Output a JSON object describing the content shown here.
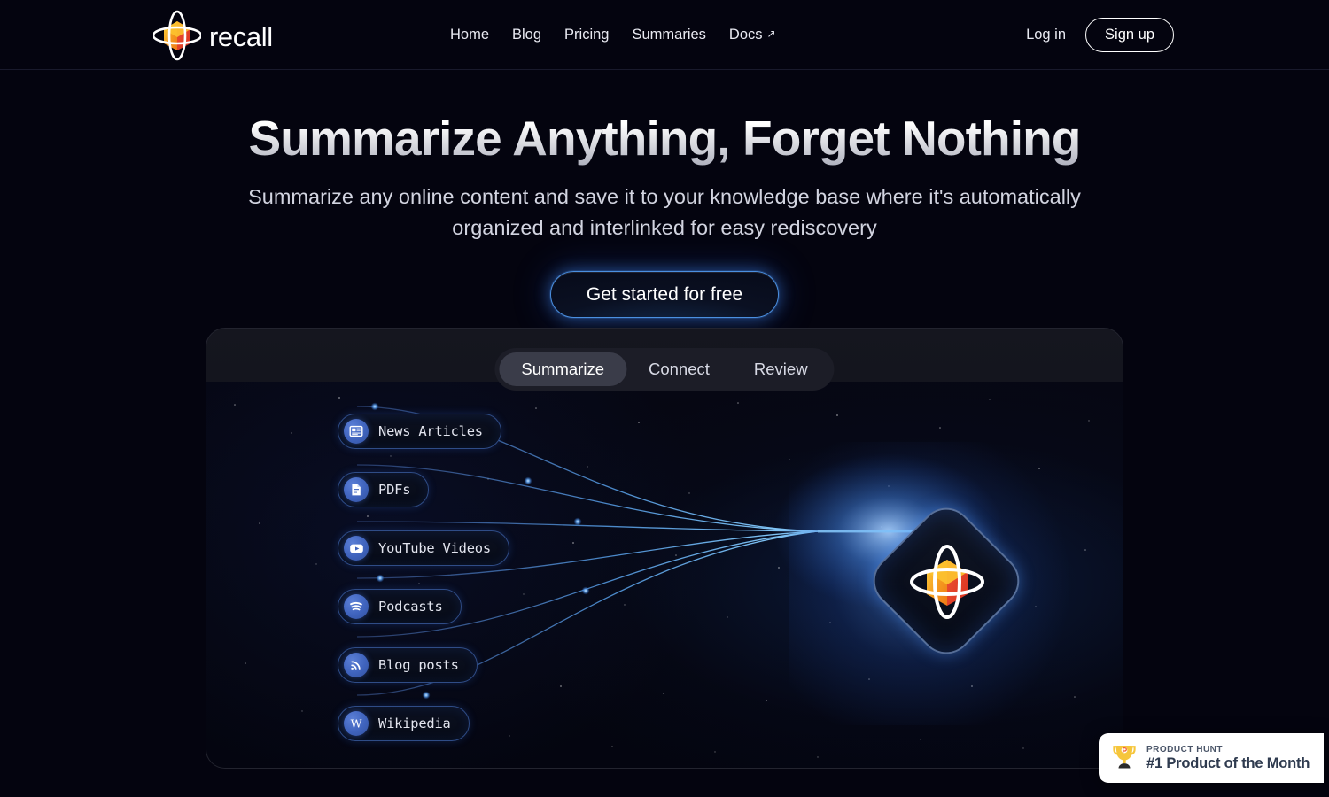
{
  "header": {
    "brand_name": "recall",
    "brand_logo_icon": "recall-orbit-logo",
    "nav": [
      {
        "label": "Home",
        "icon": null
      },
      {
        "label": "Blog",
        "icon": null
      },
      {
        "label": "Pricing",
        "icon": null
      },
      {
        "label": "Summaries",
        "icon": null
      },
      {
        "label": "Docs",
        "icon": "external-link-arrow-icon",
        "arrow": "↗"
      }
    ],
    "login_label": "Log in",
    "signup_label": "Sign up"
  },
  "hero": {
    "title": "Summarize Anything, Forget Nothing",
    "subtitle": "Summarize any online content and save it to your knowledge base where it's automatically organized and interlinked for easy rediscovery",
    "cta_label": "Get started for free"
  },
  "demo": {
    "tabs": [
      {
        "label": "Summarize",
        "active": true
      },
      {
        "label": "Connect",
        "active": false
      },
      {
        "label": "Review",
        "active": false
      }
    ],
    "sources": [
      {
        "label": "News Articles",
        "icon": "newspaper-icon"
      },
      {
        "label": "PDFs",
        "icon": "document-icon"
      },
      {
        "label": "YouTube Videos",
        "icon": "youtube-icon"
      },
      {
        "label": "Podcasts",
        "icon": "spotify-icon"
      },
      {
        "label": "Blog posts",
        "icon": "rss-icon"
      },
      {
        "label": "Wikipedia",
        "icon": "wikipedia-w-icon"
      }
    ],
    "center_node_icon": "recall-orbit-logo"
  },
  "product_hunt": {
    "kicker": "PRODUCT HUNT",
    "title": "#1 Product of the Month",
    "icon": "trophy-icon"
  },
  "colors": {
    "page_background": "#04040f",
    "panel_background": "#13141d",
    "accent_blue": "#4b8fe0",
    "chip_border": "#2f4c86",
    "logo_orange": "#f5a623",
    "logo_red": "#e8402a",
    "badge_background": "#ffffff",
    "badge_text": "#2f3b4f"
  }
}
